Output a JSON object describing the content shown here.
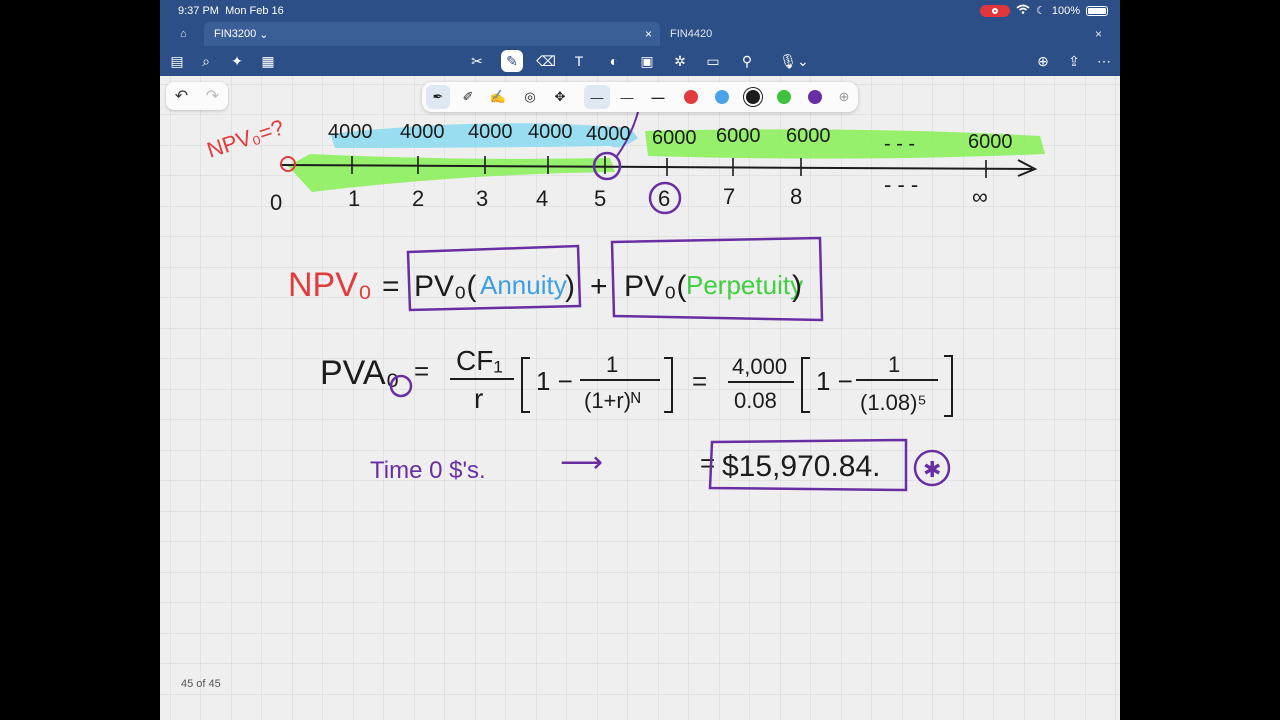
{
  "status": {
    "time": "9:37 PM",
    "date": "Mon Feb 16",
    "battery": "100%"
  },
  "tabs": [
    {
      "label": "FIN3200",
      "active": true
    },
    {
      "label": "FIN4420",
      "active": false
    }
  ],
  "icons": {
    "home": "⌂",
    "close": "×",
    "sidebar": "▤",
    "search": "⌕",
    "sparkle": "✦",
    "document": "▦",
    "lasso": "✂",
    "pen": "✎",
    "eraser": "⌫",
    "text": "T",
    "shapes": "◐",
    "image": "▣",
    "stickers": "✲",
    "note": "▭",
    "link": "⚲",
    "mic": "🎙",
    "new-page": "⊕",
    "share": "⇪",
    "more": "⋯",
    "undo": "↶",
    "redo": "↷",
    "add-color": "⊕"
  },
  "pen_toolbar": {
    "widths": [
      "—",
      "—",
      "—"
    ],
    "colors": [
      "#e23b3b",
      "#4aa3e8",
      "#1c1c1c",
      "#3cc43c",
      "#6a2ea3"
    ]
  },
  "notes": {
    "npv_question": "NPV₀=?",
    "annuity_cfs": [
      "4000",
      "4000",
      "4000",
      "4000",
      "4000"
    ],
    "perpetuity_cfs": [
      "6000",
      "6000",
      "6000",
      "- - -",
      "6000"
    ],
    "timeline_labels": [
      "0",
      "1",
      "2",
      "3",
      "4",
      "5",
      "6",
      "7",
      "8",
      "- - -",
      "∞"
    ],
    "npv_label": "NPV₀",
    "pv_label": "PV₀(",
    "annuity_word": "Annuity",
    "perpetuity_word": "Perpetuity",
    "close_paren": ")",
    "equals": "=",
    "plus": "+",
    "pva_label": "PVA₀",
    "cf1": "CF₁",
    "r": "r",
    "bracket_one": "1 −",
    "one": "1",
    "denom1": "(1+r)ᴺ",
    "num2": "4,000",
    "den2": "0.08",
    "denom2": "(1.08)⁵",
    "time0": "Time 0 $'s.",
    "arrow": "⟶",
    "result": "$15,970.84.",
    "star": "✱"
  },
  "page": {
    "indicator": "45 of 45"
  },
  "colors": {
    "red": "#e23b3b",
    "blue": "#3d9ee6",
    "green": "#3fcf3f",
    "purple": "#6a2ea3",
    "black": "#1c1c1c",
    "highlight_blue": "#8fdcf0",
    "highlight_green": "#8cf05c"
  }
}
